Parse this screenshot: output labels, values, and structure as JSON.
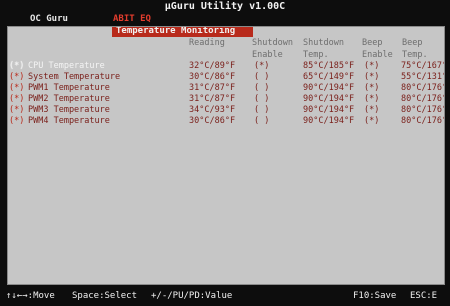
{
  "app": {
    "title": "µGuru Utility v1.00C"
  },
  "menu": {
    "items": [
      "OC Guru",
      "ABIT EQ"
    ]
  },
  "tab": {
    "label": "Temperature Monitoring"
  },
  "columns": {
    "reading": "Reading",
    "shutdown_enable_1": "Shutdown",
    "shutdown_enable_2": "Enable",
    "shutdown_temp_1": "Shutdown",
    "shutdown_temp_2": "Temp.",
    "beep_enable_1": "Beep",
    "beep_enable_2": "Enable",
    "beep_temp_1": "Beep",
    "beep_temp_2": "Temp."
  },
  "rows": [
    {
      "marker": "(*)",
      "name": "CPU Temperature",
      "reading": "32°C/89°F",
      "shutdown_enable": "(*)",
      "shutdown_temp": "85°C/185°F",
      "beep_enable": "(*)",
      "beep_temp": "75°C/167°"
    },
    {
      "marker": "(*)",
      "name": "System Temperature",
      "reading": "30°C/86°F",
      "shutdown_enable": "( )",
      "shutdown_temp": "65°C/149°F",
      "beep_enable": "(*)",
      "beep_temp": "55°C/131°"
    },
    {
      "marker": "(*)",
      "name": "PWM1 Temperature",
      "reading": "31°C/87°F",
      "shutdown_enable": "( )",
      "shutdown_temp": "90°C/194°F",
      "beep_enable": "(*)",
      "beep_temp": "80°C/176°"
    },
    {
      "marker": "(*)",
      "name": "PWM2 Temperature",
      "reading": "31°C/87°F",
      "shutdown_enable": "( )",
      "shutdown_temp": "90°C/194°F",
      "beep_enable": "(*)",
      "beep_temp": "80°C/176°"
    },
    {
      "marker": "(*)",
      "name": "PWM3 Temperature",
      "reading": "34°C/93°F",
      "shutdown_enable": "( )",
      "shutdown_temp": "90°C/194°F",
      "beep_enable": "(*)",
      "beep_temp": "80°C/176°"
    },
    {
      "marker": "(*)",
      "name": "PWM4 Temperature",
      "reading": "30°C/86°F",
      "shutdown_enable": "( )",
      "shutdown_temp": "90°C/194°F",
      "beep_enable": "(*)",
      "beep_temp": "80°C/176°"
    }
  ],
  "footer": {
    "move": "↑↓←→:Move",
    "select": "Space:Select",
    "value": "+/-/PU/PD:Value",
    "save": "F10:Save",
    "exit": "ESC:E"
  }
}
